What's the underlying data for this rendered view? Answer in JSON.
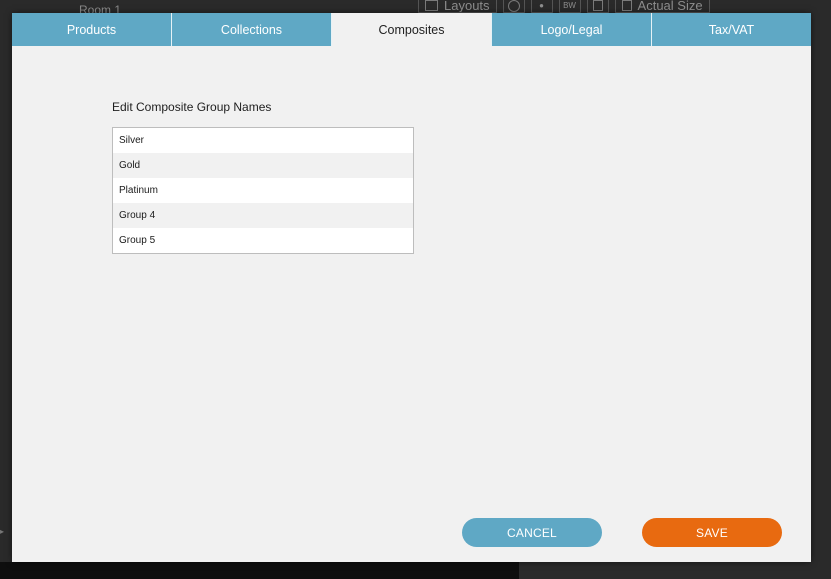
{
  "background": {
    "room_label": "Room 1",
    "toolbar": {
      "layouts_label": "Layouts",
      "bw_label": "BW",
      "actual_size_label": "Actual Size"
    }
  },
  "tabs": [
    {
      "label": "Products",
      "active": false
    },
    {
      "label": "Collections",
      "active": false
    },
    {
      "label": "Composites",
      "active": true
    },
    {
      "label": "Logo/Legal",
      "active": false
    },
    {
      "label": "Tax/VAT",
      "active": false
    }
  ],
  "composites": {
    "section_label": "Edit Composite Group Names",
    "group_names": [
      "Silver",
      "Gold",
      "Platinum",
      "Group 4",
      "Group 5"
    ]
  },
  "buttons": {
    "cancel_label": "CANCEL",
    "save_label": "SAVE"
  },
  "colors": {
    "tab_blue": "#5fa8c5",
    "save_orange": "#e86a10",
    "dialog_bg": "#f1f1f1"
  }
}
